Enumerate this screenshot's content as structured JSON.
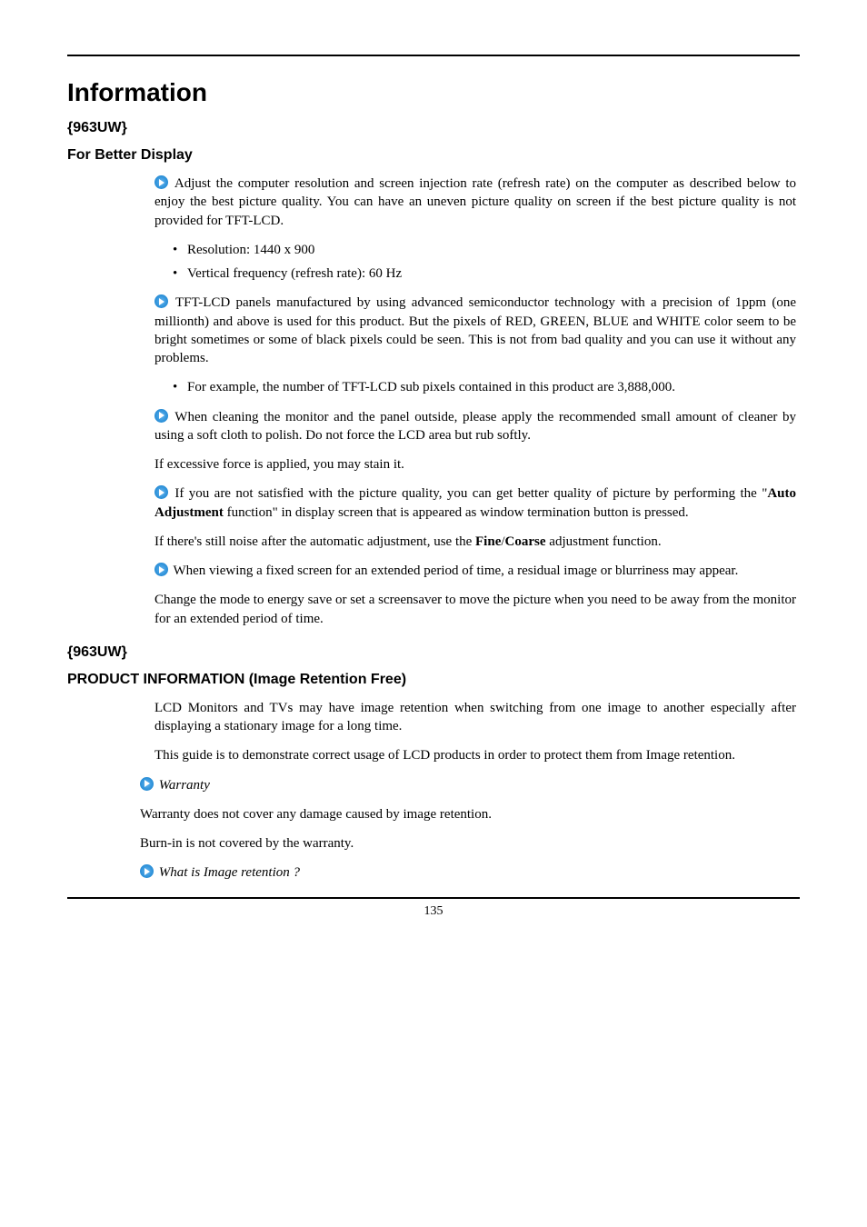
{
  "page_number": "135",
  "title": "Information",
  "section1": {
    "model": "{963UW}",
    "heading": "For Better Display",
    "p1": " Adjust the computer resolution and screen injection rate (refresh rate) on the computer as described below to enjoy the best picture quality. You can have an uneven picture quality on screen if the best picture quality is not provided for TFT-LCD.",
    "bullets1": {
      "b1": "Resolution: 1440 x 900",
      "b2": "Vertical frequency (refresh rate): 60 Hz"
    },
    "p2": " TFT-LCD panels manufactured by using advanced semiconductor technology with a precision of 1ppm (one millionth) and above is used for this product. But the pixels of RED, GREEN, BLUE and WHITE color seem to be bright sometimes or some of black pixels could be seen. This is not from bad quality and you can use it without any problems.",
    "bullets2": {
      "b1": "For example, the number of TFT-LCD sub pixels contained in this product are 3,888,000."
    },
    "p3": " When cleaning the monitor and the panel outside, please apply the recommended small amount of cleaner by using a soft cloth to polish. Do not force the LCD area but rub softly.",
    "p4": "If excessive force is applied, you may stain it.",
    "p5_pre": " If you are not satisfied with the picture quality, you can get better quality of picture by performing the \"",
    "p5_bold": "Auto Adjustment",
    "p5_post": " function\" in display screen that is appeared as window termination button is pressed.",
    "p6_pre": "If there's still noise after the automatic adjustment, use the ",
    "p6_b1": "Fine",
    "p6_sep": "/",
    "p6_b2": "Coarse",
    "p6_post": " adjustment function.",
    "p7": " When viewing a fixed screen for an extended period of time, a residual image or blurriness may appear.",
    "p8": "Change the mode to energy save or set a screensaver to move the picture when you need to be away from the monitor for an extended period of time."
  },
  "section2": {
    "model": "{963UW}",
    "heading": "PRODUCT INFORMATION (Image Retention Free)",
    "p1": "LCD Monitors and TVs may have image retention when switching from one image to another especially after displaying a stationary image for a long time.",
    "p2": "This guide is to demonstrate correct usage of LCD products in order to protect them from Image retention.",
    "sub1": "Warranty",
    "p3": "Warranty does not cover any damage caused by image retention.",
    "p4": "Burn-in is not covered by the warranty.",
    "sub2": "What is Image retention ?"
  }
}
